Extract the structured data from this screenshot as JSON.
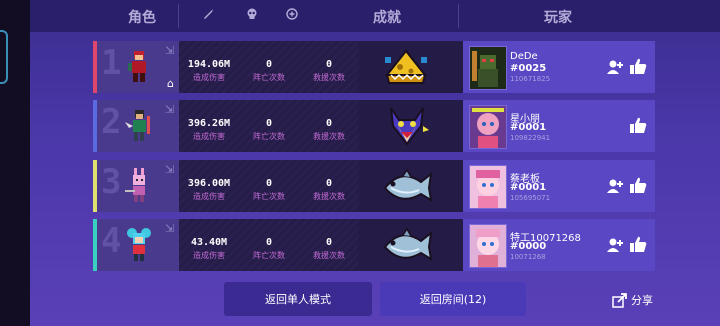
{
  "header": {
    "role": "角色",
    "achievement": "成就",
    "player": "玩家"
  },
  "stats_labels": {
    "damage": "造成伤害",
    "deaths": "阵亡次数",
    "rescues": "救援次数"
  },
  "rows": [
    {
      "rank": "1",
      "stripe_color": "#e0456a",
      "damage": "194.06M",
      "deaths": "0",
      "rescues": "0",
      "player_name": "DeDe",
      "player_id": "#0025",
      "player_uid": "110671825",
      "achievement_icon": "cheese-monster-icon",
      "has_add_button": true
    },
    {
      "rank": "2",
      "stripe_color": "#5a6ae0",
      "damage": "396.26M",
      "deaths": "0",
      "rescues": "0",
      "player_name": "星小朋",
      "player_id": "#0001",
      "player_uid": "109822941",
      "achievement_icon": "wolf-head-icon",
      "has_add_button": false
    },
    {
      "rank": "3",
      "stripe_color": "#e0e070",
      "damage": "396.00M",
      "deaths": "0",
      "rescues": "0",
      "player_name": "蔡老板",
      "player_id": "#0001",
      "player_uid": "105695071",
      "achievement_icon": "fish-icon",
      "has_add_button": true
    },
    {
      "rank": "4",
      "stripe_color": "#3ad0c0",
      "damage": "43.40M",
      "deaths": "0",
      "rescues": "0",
      "player_name": "特工10071268",
      "player_id": "#0000",
      "player_uid": "10071268",
      "achievement_icon": "fish-icon",
      "has_add_button": true
    }
  ],
  "buttons": {
    "back_single": "返回单人模式",
    "back_room": "返回房间(12)",
    "share": "分享"
  },
  "colors": {
    "button_primary": "#4a3ab8",
    "button_secondary": "#3a2a92",
    "header_bg": "#2a1f6a"
  }
}
